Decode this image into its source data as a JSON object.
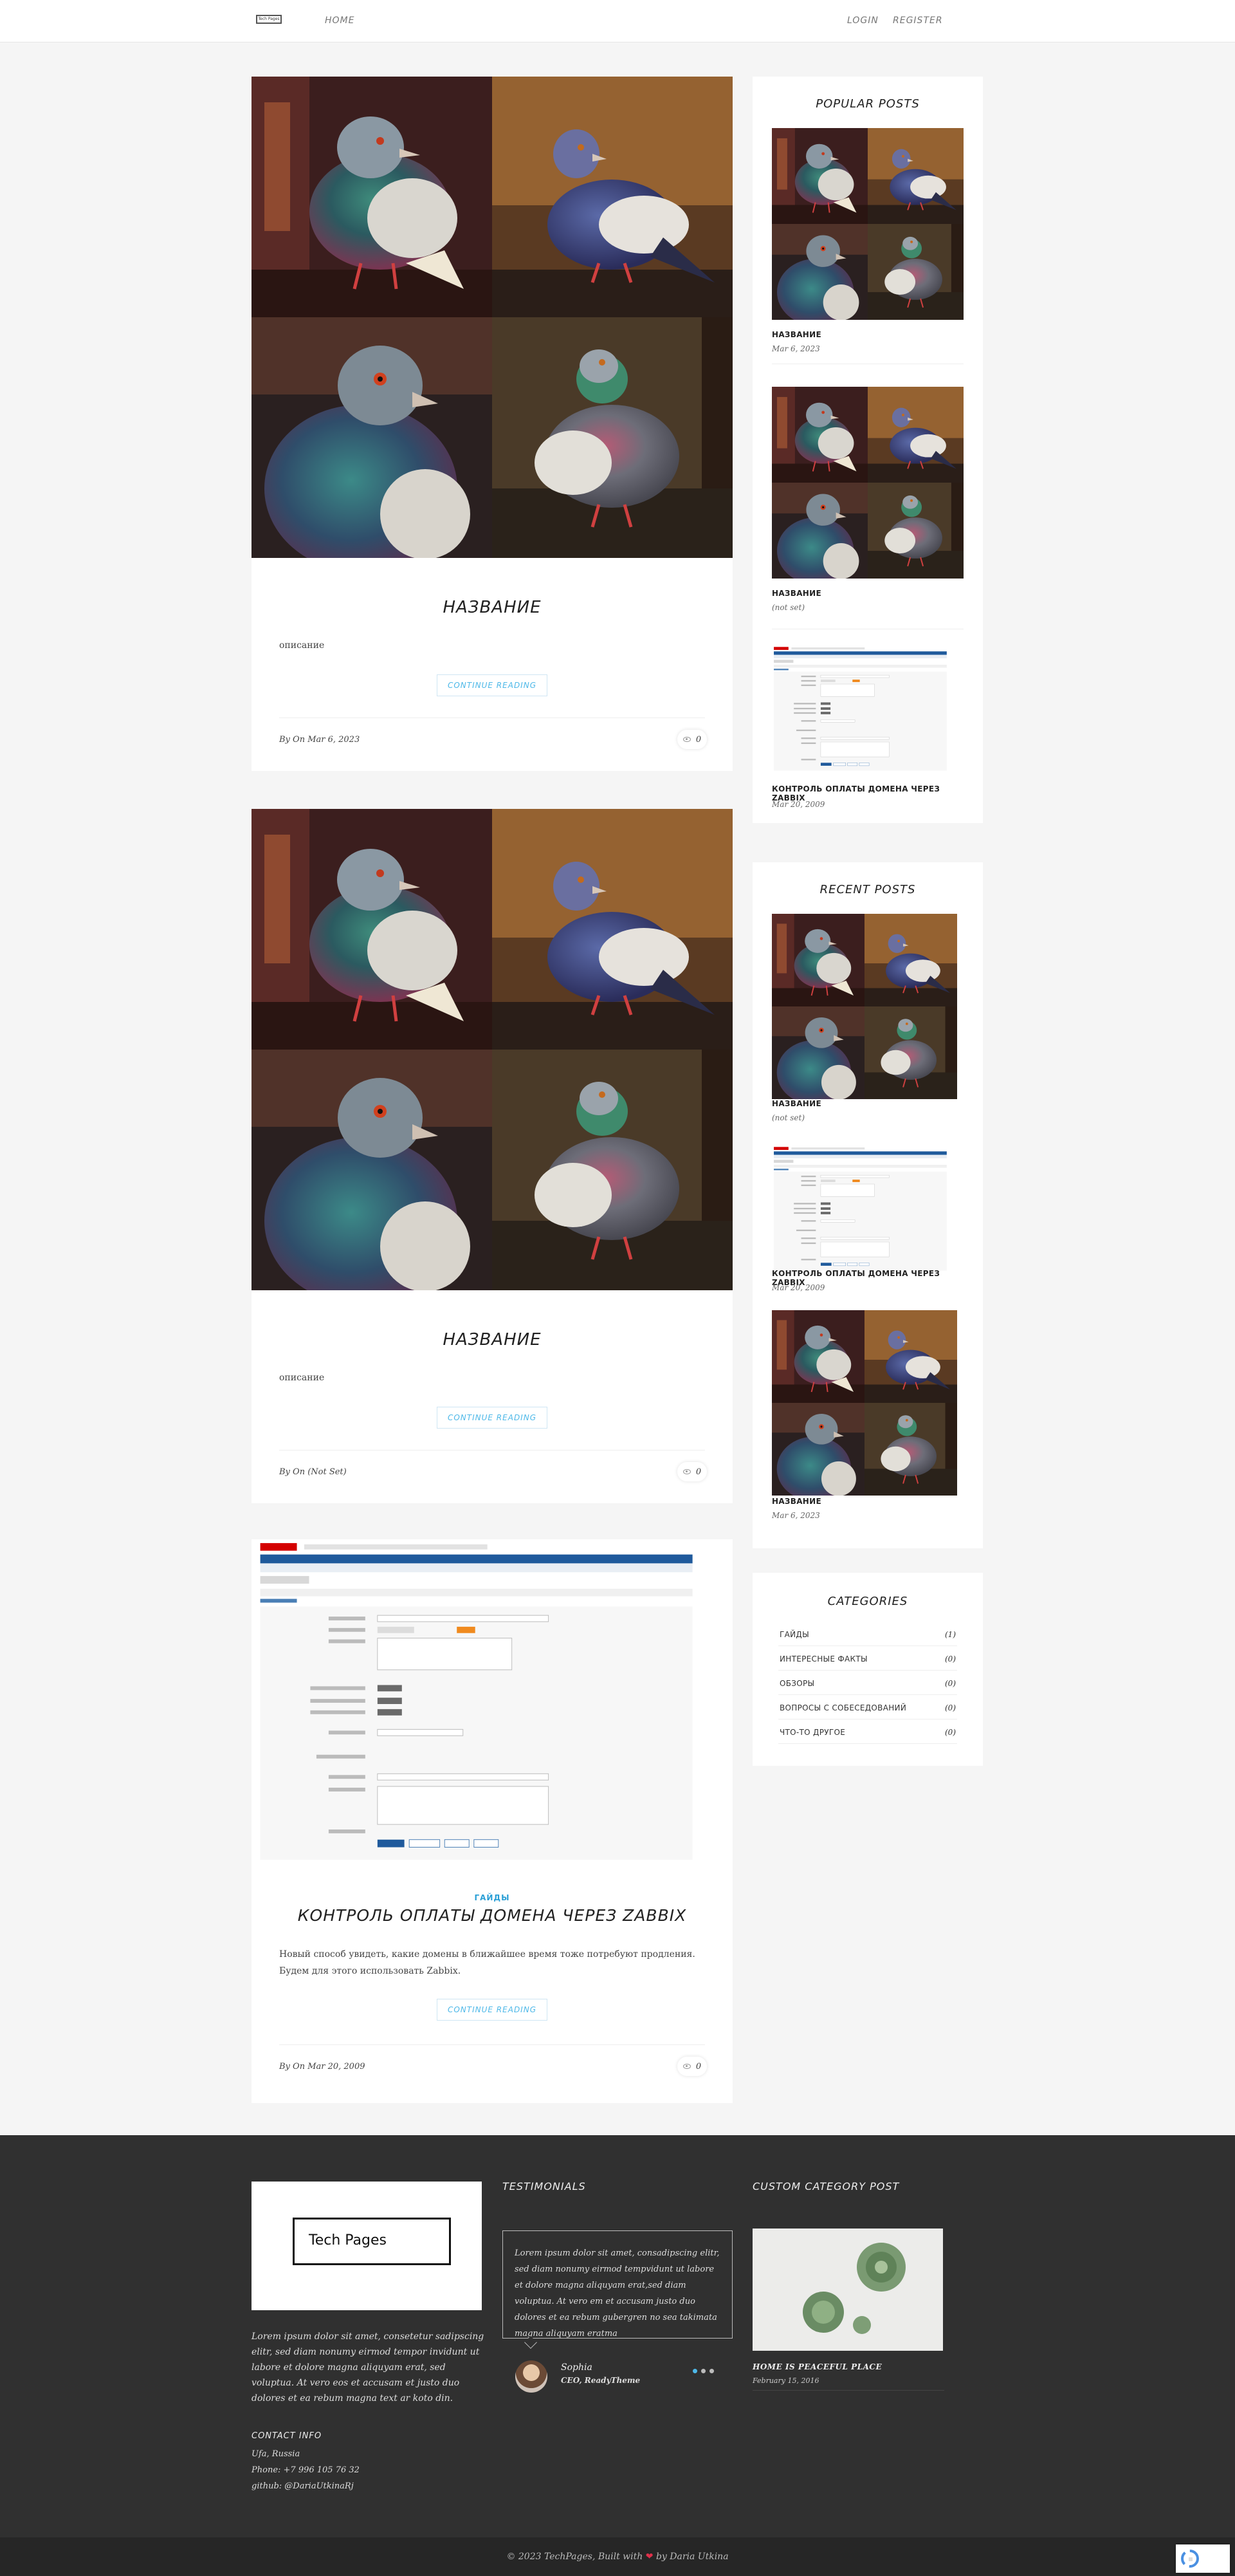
{
  "header": {
    "logo_text": "Tech Pages",
    "nav_home": "HOME",
    "nav_login": "LOGIN",
    "nav_register": "REGISTER"
  },
  "posts": [
    {
      "title": "НАЗВАНИЕ",
      "excerpt": "описание",
      "read_more": "CONTINUE READING",
      "meta": "By On Mar 6, 2023",
      "views": "0",
      "image": "pigeon-collage"
    },
    {
      "title": "НАЗВАНИЕ",
      "excerpt": "описание",
      "read_more": "CONTINUE READING",
      "meta": "By On (Not Set)",
      "views": "0",
      "image": "pigeon-collage"
    },
    {
      "category": "ГАЙДЫ",
      "title": "КОНТРОЛЬ ОПЛАТЫ ДОМЕНА ЧЕРЕЗ ZABBIX",
      "excerpt": "Новый способ увидеть, какие домены в ближайшее время тоже потребуют продления. Будем для этого использовать Zabbix.",
      "read_more": "CONTINUE READING",
      "meta": "By On Mar 20, 2009",
      "views": "0",
      "image": "zabbix-screenshot"
    }
  ],
  "zabbix": {
    "logo": "ZABBIX",
    "menu": [
      "Мониторинг",
      "Инвентаризация",
      "Отчеты",
      "Настройка",
      "Администрирование"
    ],
    "submenu": [
      "Группы узлов сети",
      "Шаблоны",
      "Узлы сети",
      "Обслуживание",
      "Действия",
      "Корреляция событий",
      "Обнаружение",
      "Услуги IT"
    ],
    "page_title": "Триггеры",
    "tabs": [
      "Триггер",
      "Зависимости"
    ],
    "field_name": "Имя",
    "field_severity": "Важность",
    "field_expression": "Выражение",
    "btn_add": "Добавить"
  },
  "popular_posts": {
    "title": "POPULAR POSTS",
    "items": [
      {
        "title": "НАЗВАНИЕ",
        "date": "Mar 6, 2023",
        "image": "pigeon-collage-b"
      },
      {
        "title": "НАЗВАНИЕ",
        "date": "(not set)",
        "image": "pigeon-collage"
      },
      {
        "title": "КОНТРОЛЬ ОПЛАТЫ ДОМЕНА ЧЕРЕЗ ZABBIX",
        "date": "Mar 20, 2009",
        "image": "zabbix-screenshot"
      }
    ]
  },
  "recent_posts": {
    "title": "RECENT POSTS",
    "items": [
      {
        "title": "НАЗВАНИЕ",
        "date": "(not set)",
        "image": "pigeon-collage"
      },
      {
        "title": "КОНТРОЛЬ ОПЛАТЫ ДОМЕНА ЧЕРЕЗ ZABBIX",
        "date": "Mar 20, 2009",
        "image": "zabbix-screenshot"
      },
      {
        "title": "НАЗВАНИЕ",
        "date": "Mar 6, 2023",
        "image": "pigeon-collage"
      }
    ]
  },
  "categories": {
    "title": "CATEGORIES",
    "items": [
      {
        "name": "ГАЙДЫ",
        "count": "(1)"
      },
      {
        "name": "ИНТЕРЕСНЫЕ ФАКТЫ",
        "count": "(0)"
      },
      {
        "name": "ОБЗОРЫ",
        "count": "(0)"
      },
      {
        "name": "ВОПРОСЫ С СОБЕСЕДОВАНИЙ",
        "count": "(0)"
      },
      {
        "name": "ЧТО-ТО ДРУГОЕ",
        "count": "(0)"
      }
    ]
  },
  "footer": {
    "logo_text": "Tech Pages",
    "about": "Lorem ipsum dolor sit amet, consetetur sadipscing elitr, sed diam nonumy eirmod tempor invidunt ut labore et dolore magna aliquyam erat, sed voluptua. At vero eos et accusam et justo duo dolores et ea rebum magna text ar koto din.",
    "contact_title": "CONTACT INFO",
    "contact_city": "Ufa, Russia",
    "contact_phone": "Phone: +7 996 105 76 32",
    "contact_github": "github: @DariaUtkinaRj",
    "testimonials_title": "TESTIMONIALS",
    "testimonial_text": "Lorem ipsum dolor sit amet, consadipscing elitr, sed diam nonumy eirmod tempvidunt ut labore et dolore magna aliquyam erat,sed diam voluptua. At vero em et accusam justo duo dolores et ea rebum gubergren no sea takimata magna aliquyam eratma",
    "testimonial_name": "Sophia",
    "testimonial_role": "CEO, ReadyTheme",
    "custom_title": "CUSTOM CATEGORY POST",
    "custom_post_title": "HOME IS PEACEFUL PLACE",
    "custom_post_date": "February 15, 2016",
    "copyright_pre": "© 2023 TechPages, Built with",
    "copyright_post": "by Daria Utkina"
  },
  "colors": {
    "accent": "#4db8e8",
    "footer_bg": "#303030",
    "page_bg": "#f5f5f5",
    "heart": "#e0304a"
  }
}
